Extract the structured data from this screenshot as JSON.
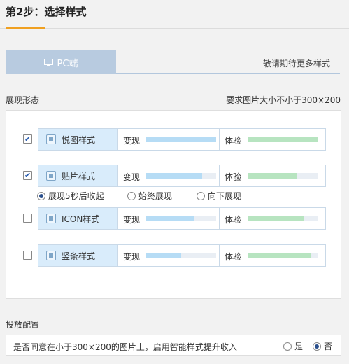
{
  "step": {
    "title": "第2步：选择样式"
  },
  "tabs": {
    "pc_label": "PC端",
    "more_label": "敬请期待更多样式"
  },
  "display": {
    "section_label": "展现形态",
    "size_note": "要求图片大小不小于300×200",
    "styles": [
      {
        "name": "悦图样式",
        "checked": true,
        "icon": "picture-frame-icon",
        "bianxian_label": "变现",
        "bianxian_level": 1.0,
        "tiyan_label": "体验",
        "tiyan_level": 1.0
      },
      {
        "name": "贴片样式",
        "checked": true,
        "icon": "image-icon",
        "bianxian_label": "变现",
        "bianxian_level": 0.8,
        "tiyan_label": "体验",
        "tiyan_level": 0.7
      },
      {
        "name": "ICON样式",
        "checked": false,
        "icon": "window-icon",
        "bianxian_label": "变现",
        "bianxian_level": 0.68,
        "tiyan_label": "体验",
        "tiyan_level": 0.8
      },
      {
        "name": "竖条样式",
        "checked": false,
        "icon": "vertical-bar-icon",
        "bianxian_label": "变现",
        "bianxian_level": 0.5,
        "tiyan_label": "体验",
        "tiyan_level": 0.9
      }
    ],
    "radios": [
      {
        "label": "展现5秒后收起",
        "selected": true
      },
      {
        "label": "始终展现",
        "selected": false
      },
      {
        "label": "向下展现",
        "selected": false
      }
    ]
  },
  "deploy": {
    "section_label": "投放配置",
    "question": "是否同意在小于300×200的图片上，启用智能样式提升收入",
    "yes_label": "是",
    "no_label": "否",
    "selected": "no"
  },
  "colors": {
    "accent": "#f0a020",
    "tab_bg": "#b8cbe0",
    "bar_blue": "#b6dcf5",
    "bar_green": "#b7e4c0",
    "name_bg": "#d9ecfb"
  }
}
